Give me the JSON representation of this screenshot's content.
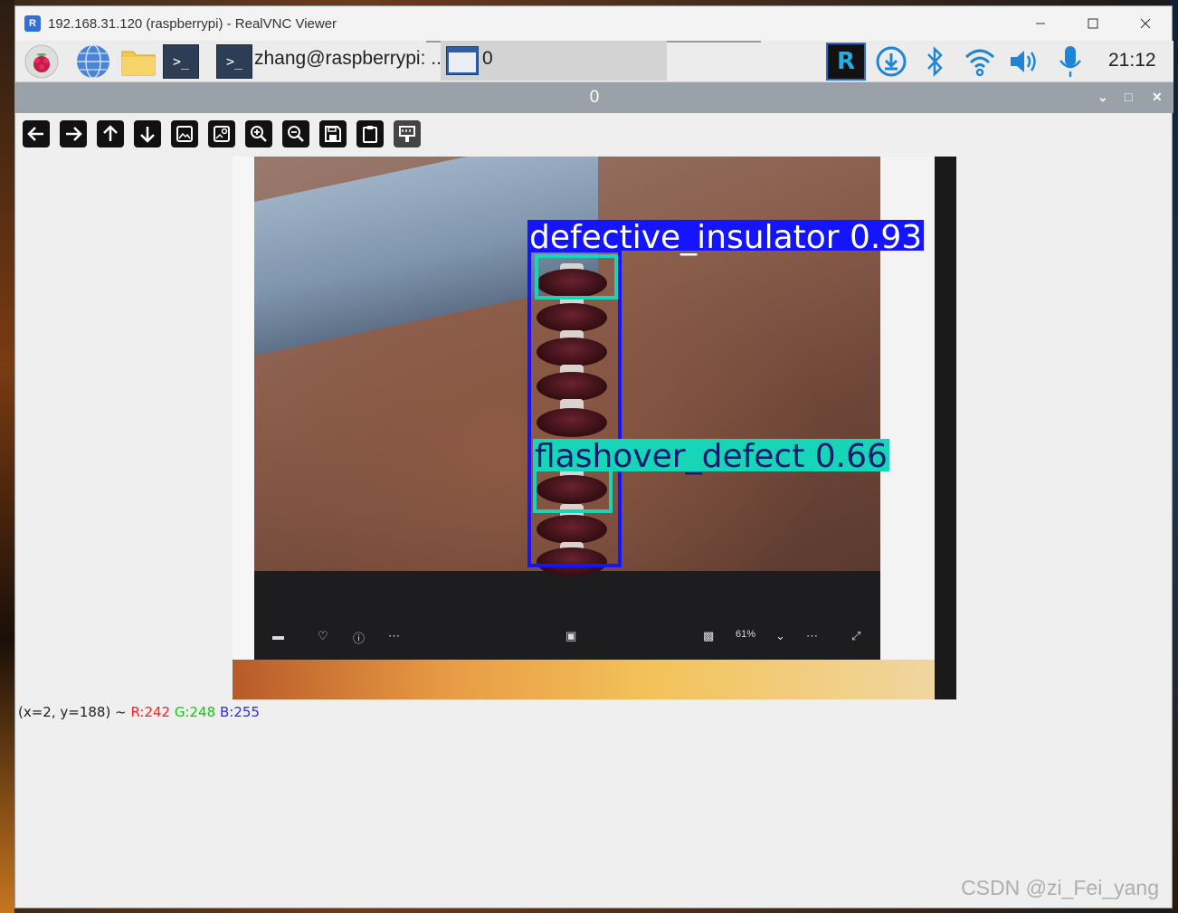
{
  "window": {
    "title": "192.168.31.120 (raspberrypi) - RealVNC Viewer",
    "app_icon": "realvnc-icon",
    "controls": [
      "minimize-icon",
      "maximize-icon",
      "close-icon"
    ]
  },
  "rpi_taskbar": {
    "launchers": [
      "raspberry-menu-icon",
      "web-browser-icon",
      "file-manager-icon",
      "terminal-icon"
    ],
    "tasks": [
      {
        "label": "zhang@raspberrypi: ...",
        "icon": "terminal-icon"
      },
      {
        "label": "0",
        "icon": "window-icon",
        "active": true
      }
    ],
    "tray": [
      "realvnc-server-icon",
      "updater-icon",
      "bluetooth-icon",
      "wifi-icon",
      "volume-icon",
      "microphone-icon"
    ],
    "clock": "21:12"
  },
  "cv_window": {
    "title": "0",
    "controls": [
      "chevron-down-icon",
      "restore-icon",
      "close-icon"
    ],
    "toolbar": [
      "arrow-left-icon",
      "arrow-right-icon",
      "arrow-up-icon",
      "arrow-down-icon",
      "image-icon",
      "image-settings-icon",
      "zoom-in-icon",
      "zoom-out-icon",
      "save-icon",
      "clipboard-icon",
      "properties-icon"
    ]
  },
  "detections": [
    {
      "label": "defective_insulator 0.93",
      "color": "#1414ff"
    },
    {
      "label": "flashover_defect 0.66",
      "color": "#17d6b8"
    }
  ],
  "overlay_labels": {
    "zoom": "61%"
  },
  "status": {
    "coords": "(x=2, y=188) ~",
    "r": "R:242",
    "g": "G:248",
    "b": "B:255",
    "colors": {
      "r": "#ff2020",
      "g": "#19c219",
      "b": "#2a2aff"
    }
  },
  "watermark": "CSDN @zi_Fei_yang"
}
